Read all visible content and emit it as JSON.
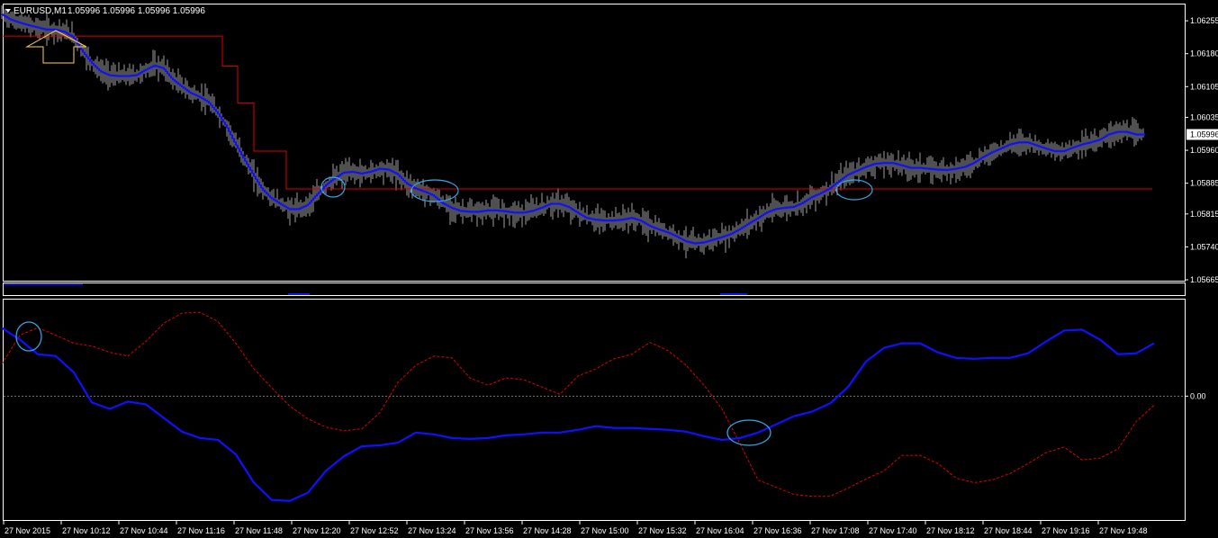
{
  "header": {
    "symbol": "EURUSD,M1",
    "ohlc": "1.05996 1.05996 1.05996 1.05996"
  },
  "colors": {
    "background": "#000000",
    "frame": "#ffffff",
    "price": "#a0a0a0",
    "moving_average": "#1010ff",
    "stop_line": "#e00000",
    "oscillator_main": "#1010ff",
    "oscillator_signal": "#e00000",
    "highlight_circle": "#33aaee",
    "arrow_marker": "#ffd24a",
    "current_price_bg": "#ffffff",
    "current_price_text": "#000000"
  },
  "chart_data": [
    {
      "type": "line",
      "name": "price",
      "ylim": [
        1.05665,
        1.0629
      ],
      "y_ticks": [
        "1.06255",
        "1.06180",
        "1.06105",
        "1.06035",
        "1.05960",
        "1.05885",
        "1.05815",
        "1.05740",
        "1.05665"
      ],
      "current_price": "1.05996",
      "x_labels": [
        "27 Nov 2015",
        "27 Nov 10:12",
        "27 Nov 10:44",
        "27 Nov 11:16",
        "27 Nov 11:48",
        "27 Nov 12:20",
        "27 Nov 12:52",
        "27 Nov 13:24",
        "27 Nov 13:56",
        "27 Nov 14:28",
        "27 Nov 15:00",
        "27 Nov 15:32",
        "27 Nov 16:04",
        "27 Nov 16:36",
        "27 Nov 17:08",
        "27 Nov 17:40",
        "27 Nov 18:12",
        "27 Nov 18:44",
        "27 Nov 19:16",
        "27 Nov 19:48"
      ],
      "x": [
        0,
        10,
        20,
        30,
        40,
        50,
        60,
        70,
        80,
        90,
        100,
        110,
        120,
        130,
        140,
        150,
        160,
        170,
        180,
        190,
        200,
        210,
        220,
        230,
        240,
        250,
        260,
        270,
        280,
        290,
        300,
        310,
        320,
        330,
        340,
        350,
        360,
        370,
        380,
        390,
        400,
        410,
        420,
        430,
        440,
        450,
        460,
        470,
        480,
        490,
        500,
        510,
        520,
        530,
        540,
        550,
        560,
        570,
        580,
        590,
        600,
        610,
        620,
        630,
        640,
        650,
        660,
        670,
        680,
        690,
        700,
        710,
        720,
        730,
        740,
        750,
        760,
        770,
        780,
        790,
        800,
        810,
        820,
        830,
        840,
        850,
        860,
        870,
        880,
        890,
        900,
        910,
        920,
        930,
        940,
        950,
        960,
        970,
        980,
        990,
        1000,
        1010,
        1020,
        1030,
        1040,
        1050,
        1060,
        1070,
        1080,
        1090,
        1100,
        1110,
        1120,
        1130,
        1140,
        1150,
        1160,
        1170,
        1180,
        1190,
        1200,
        1210,
        1220,
        1230,
        1240,
        1250,
        1260,
        1270
      ],
      "series": [
        {
          "values": [
            1.0627,
            1.06258,
            1.06251,
            1.06245,
            1.0624,
            1.06235,
            1.06235,
            1.0623,
            1.06218,
            1.06186,
            1.0616,
            1.0614,
            1.06131,
            1.06129,
            1.06129,
            1.06131,
            1.06143,
            1.06153,
            1.06147,
            1.06122,
            1.06106,
            1.06091,
            1.06082,
            1.0607,
            1.06046,
            1.06015,
            1.05975,
            1.05939,
            1.05904,
            1.05871,
            1.05851,
            1.05838,
            1.05826,
            1.05826,
            1.05835,
            1.05858,
            1.0588,
            1.05896,
            1.05909,
            1.05911,
            1.05907,
            1.05911,
            1.05918,
            1.05916,
            1.05906,
            1.05885,
            1.05873,
            1.05866,
            1.05857,
            1.0584,
            1.05829,
            1.05822,
            1.0582,
            1.0582,
            1.05823,
            1.05823,
            1.05821,
            1.05818,
            1.05818,
            1.05822,
            1.05829,
            1.05838,
            1.05838,
            1.05831,
            1.05818,
            1.05806,
            1.05802,
            1.058,
            1.058,
            1.05802,
            1.05806,
            1.058,
            1.05788,
            1.0578,
            1.05773,
            1.05764,
            1.05753,
            1.05748,
            1.0575,
            1.05756,
            1.05762,
            1.05769,
            1.0578,
            1.05793,
            1.05805,
            1.05818,
            1.05826,
            1.05829,
            1.05831,
            1.0584,
            1.05853,
            1.05862,
            1.05873,
            1.05889,
            1.05904,
            1.05913,
            1.05922,
            1.05929,
            1.05931,
            1.05931,
            1.05926,
            1.0592,
            1.0592,
            1.05918,
            1.05916,
            1.05915,
            1.05918,
            1.05922,
            1.05931,
            1.05944,
            1.05955,
            1.05964,
            1.05973,
            1.05978,
            1.05978,
            1.05971,
            1.05964,
            1.05958,
            1.05958,
            1.05966,
            1.05973,
            1.05978,
            1.05984,
            1.05996,
            1.06002,
            1.06002,
            1.05996,
            1.05996
          ]
        }
      ]
    },
    {
      "type": "line",
      "name": "moving_average",
      "x": [
        0,
        10,
        20,
        30,
        40,
        50,
        60,
        70,
        80,
        90,
        100,
        110,
        120,
        130,
        140,
        150,
        160,
        170,
        180,
        190,
        200,
        210,
        220,
        230,
        240,
        250,
        260,
        270,
        280,
        290,
        300,
        310,
        320,
        330,
        340,
        350,
        360,
        370,
        380,
        390,
        400,
        410,
        420,
        430,
        440,
        450,
        460,
        470,
        480,
        490,
        500,
        510,
        520,
        530,
        540,
        550,
        560,
        570,
        580,
        590,
        600,
        610,
        620,
        630,
        640,
        650,
        660,
        670,
        680,
        690,
        700,
        710,
        720,
        730,
        740,
        750,
        760,
        770,
        780,
        790,
        800,
        810,
        820,
        830,
        840,
        850,
        860,
        870,
        880,
        890,
        900,
        910,
        920,
        930,
        940,
        950,
        960,
        970,
        980,
        990,
        1000,
        1010,
        1020,
        1030,
        1040,
        1050,
        1060,
        1070,
        1080,
        1090,
        1100,
        1110,
        1120,
        1130,
        1140,
        1150,
        1160,
        1170,
        1180,
        1190,
        1200,
        1210,
        1220,
        1230,
        1240,
        1250,
        1260,
        1270
      ],
      "series": [
        {
          "values": [
            1.0627,
            1.06258,
            1.06251,
            1.06245,
            1.0624,
            1.06235,
            1.06235,
            1.0623,
            1.06218,
            1.06186,
            1.0616,
            1.0614,
            1.06131,
            1.06129,
            1.06129,
            1.06131,
            1.06143,
            1.06153,
            1.06147,
            1.06122,
            1.06106,
            1.06091,
            1.06082,
            1.0607,
            1.06046,
            1.06015,
            1.05975,
            1.05939,
            1.05904,
            1.05871,
            1.05851,
            1.05838,
            1.05826,
            1.05826,
            1.05835,
            1.05858,
            1.0588,
            1.05896,
            1.05909,
            1.05911,
            1.05907,
            1.05911,
            1.05918,
            1.05916,
            1.05906,
            1.05885,
            1.05873,
            1.05866,
            1.05857,
            1.0584,
            1.05829,
            1.05822,
            1.0582,
            1.0582,
            1.05823,
            1.05823,
            1.05821,
            1.05818,
            1.05818,
            1.05822,
            1.05829,
            1.05838,
            1.05838,
            1.05831,
            1.05818,
            1.05806,
            1.05802,
            1.058,
            1.058,
            1.05802,
            1.05806,
            1.058,
            1.05788,
            1.0578,
            1.05773,
            1.05764,
            1.05753,
            1.05748,
            1.0575,
            1.05756,
            1.05762,
            1.05769,
            1.0578,
            1.05793,
            1.05805,
            1.05818,
            1.05826,
            1.05829,
            1.05831,
            1.0584,
            1.05853,
            1.05862,
            1.05873,
            1.05889,
            1.05904,
            1.05913,
            1.05922,
            1.05929,
            1.05931,
            1.05931,
            1.05926,
            1.0592,
            1.0592,
            1.05918,
            1.05916,
            1.05915,
            1.05918,
            1.05922,
            1.05931,
            1.05944,
            1.05955,
            1.05964,
            1.05973,
            1.05978,
            1.05978,
            1.05971,
            1.05964,
            1.05958,
            1.05958,
            1.05966,
            1.05973,
            1.05978,
            1.05984,
            1.05996,
            1.06002,
            1.06002,
            1.05996,
            1.05996
          ]
        }
      ]
    },
    {
      "type": "line",
      "name": "stop_line",
      "x": [
        0,
        245,
        245,
        262,
        262,
        280,
        280,
        316,
        316,
        1278
      ],
      "series": [
        {
          "values": [
            1.0622,
            1.0622,
            1.06152,
            1.06152,
            1.06068,
            1.06068,
            1.05958,
            1.05958,
            1.05872,
            1.05872
          ]
        }
      ]
    },
    {
      "type": "line",
      "name": "oscillator",
      "y_ticks": [
        "0.00"
      ],
      "ylim": [
        -1.35,
        1.05
      ],
      "x": [
        0,
        20,
        40,
        60,
        80,
        100,
        120,
        140,
        160,
        180,
        200,
        220,
        240,
        260,
        280,
        300,
        320,
        340,
        360,
        380,
        400,
        420,
        440,
        460,
        480,
        500,
        520,
        540,
        560,
        580,
        600,
        620,
        640,
        660,
        680,
        700,
        720,
        740,
        760,
        780,
        800,
        820,
        840,
        860,
        880,
        900,
        920,
        940,
        960,
        980,
        1000,
        1020,
        1040,
        1060,
        1080,
        1100,
        1120,
        1140,
        1160,
        1180,
        1200,
        1220,
        1240,
        1260,
        1280
      ],
      "series": [
        {
          "values": [
            0.75,
            0.62,
            0.46,
            0.44,
            0.26,
            -0.07,
            -0.14,
            -0.06,
            -0.09,
            -0.24,
            -0.39,
            -0.46,
            -0.48,
            -0.64,
            -0.95,
            -1.14,
            -1.15,
            -1.06,
            -0.82,
            -0.66,
            -0.55,
            -0.54,
            -0.51,
            -0.4,
            -0.42,
            -0.46,
            -0.47,
            -0.46,
            -0.43,
            -0.42,
            -0.4,
            -0.4,
            -0.37,
            -0.33,
            -0.35,
            -0.35,
            -0.36,
            -0.37,
            -0.39,
            -0.44,
            -0.48,
            -0.46,
            -0.4,
            -0.31,
            -0.22,
            -0.17,
            -0.08,
            0.1,
            0.38,
            0.53,
            0.58,
            0.58,
            0.48,
            0.42,
            0.41,
            0.42,
            0.42,
            0.47,
            0.6,
            0.72,
            0.73,
            0.62,
            0.46,
            0.47,
            0.58
          ]
        },
        {
          "values": [
            0.35,
            0.67,
            0.75,
            0.67,
            0.58,
            0.55,
            0.48,
            0.44,
            0.6,
            0.8,
            0.91,
            0.92,
            0.82,
            0.58,
            0.3,
            0.09,
            -0.11,
            -0.25,
            -0.34,
            -0.38,
            -0.36,
            -0.18,
            0.15,
            0.34,
            0.44,
            0.42,
            0.2,
            0.12,
            0.2,
            0.18,
            0.1,
            0.02,
            0.22,
            0.3,
            0.41,
            0.46,
            0.59,
            0.5,
            0.34,
            0.12,
            -0.14,
            -0.52,
            -0.92,
            -1.0,
            -1.08,
            -1.1,
            -1.1,
            -1.01,
            -0.91,
            -0.82,
            -0.65,
            -0.65,
            -0.74,
            -0.9,
            -0.95,
            -0.92,
            -0.85,
            -0.74,
            -0.62,
            -0.56,
            -0.7,
            -0.68,
            -0.58,
            -0.28,
            -0.1
          ]
        }
      ]
    }
  ],
  "annotations": [
    {
      "type": "ellipse",
      "pane": "price",
      "cx": 370,
      "cy": 208,
      "rx": 13,
      "ry": 11
    },
    {
      "type": "ellipse",
      "pane": "price",
      "cx": 483,
      "cy": 212,
      "rx": 26,
      "ry": 12
    },
    {
      "type": "ellipse",
      "pane": "price",
      "cx": 949,
      "cy": 211,
      "rx": 20,
      "ry": 11
    },
    {
      "type": "ellipse",
      "pane": "oscillator",
      "cx": 32,
      "cy": 374,
      "rx": 14,
      "ry": 16
    },
    {
      "type": "ellipse",
      "pane": "oscillator",
      "cx": 832,
      "cy": 481,
      "rx": 24,
      "ry": 14
    }
  ]
}
